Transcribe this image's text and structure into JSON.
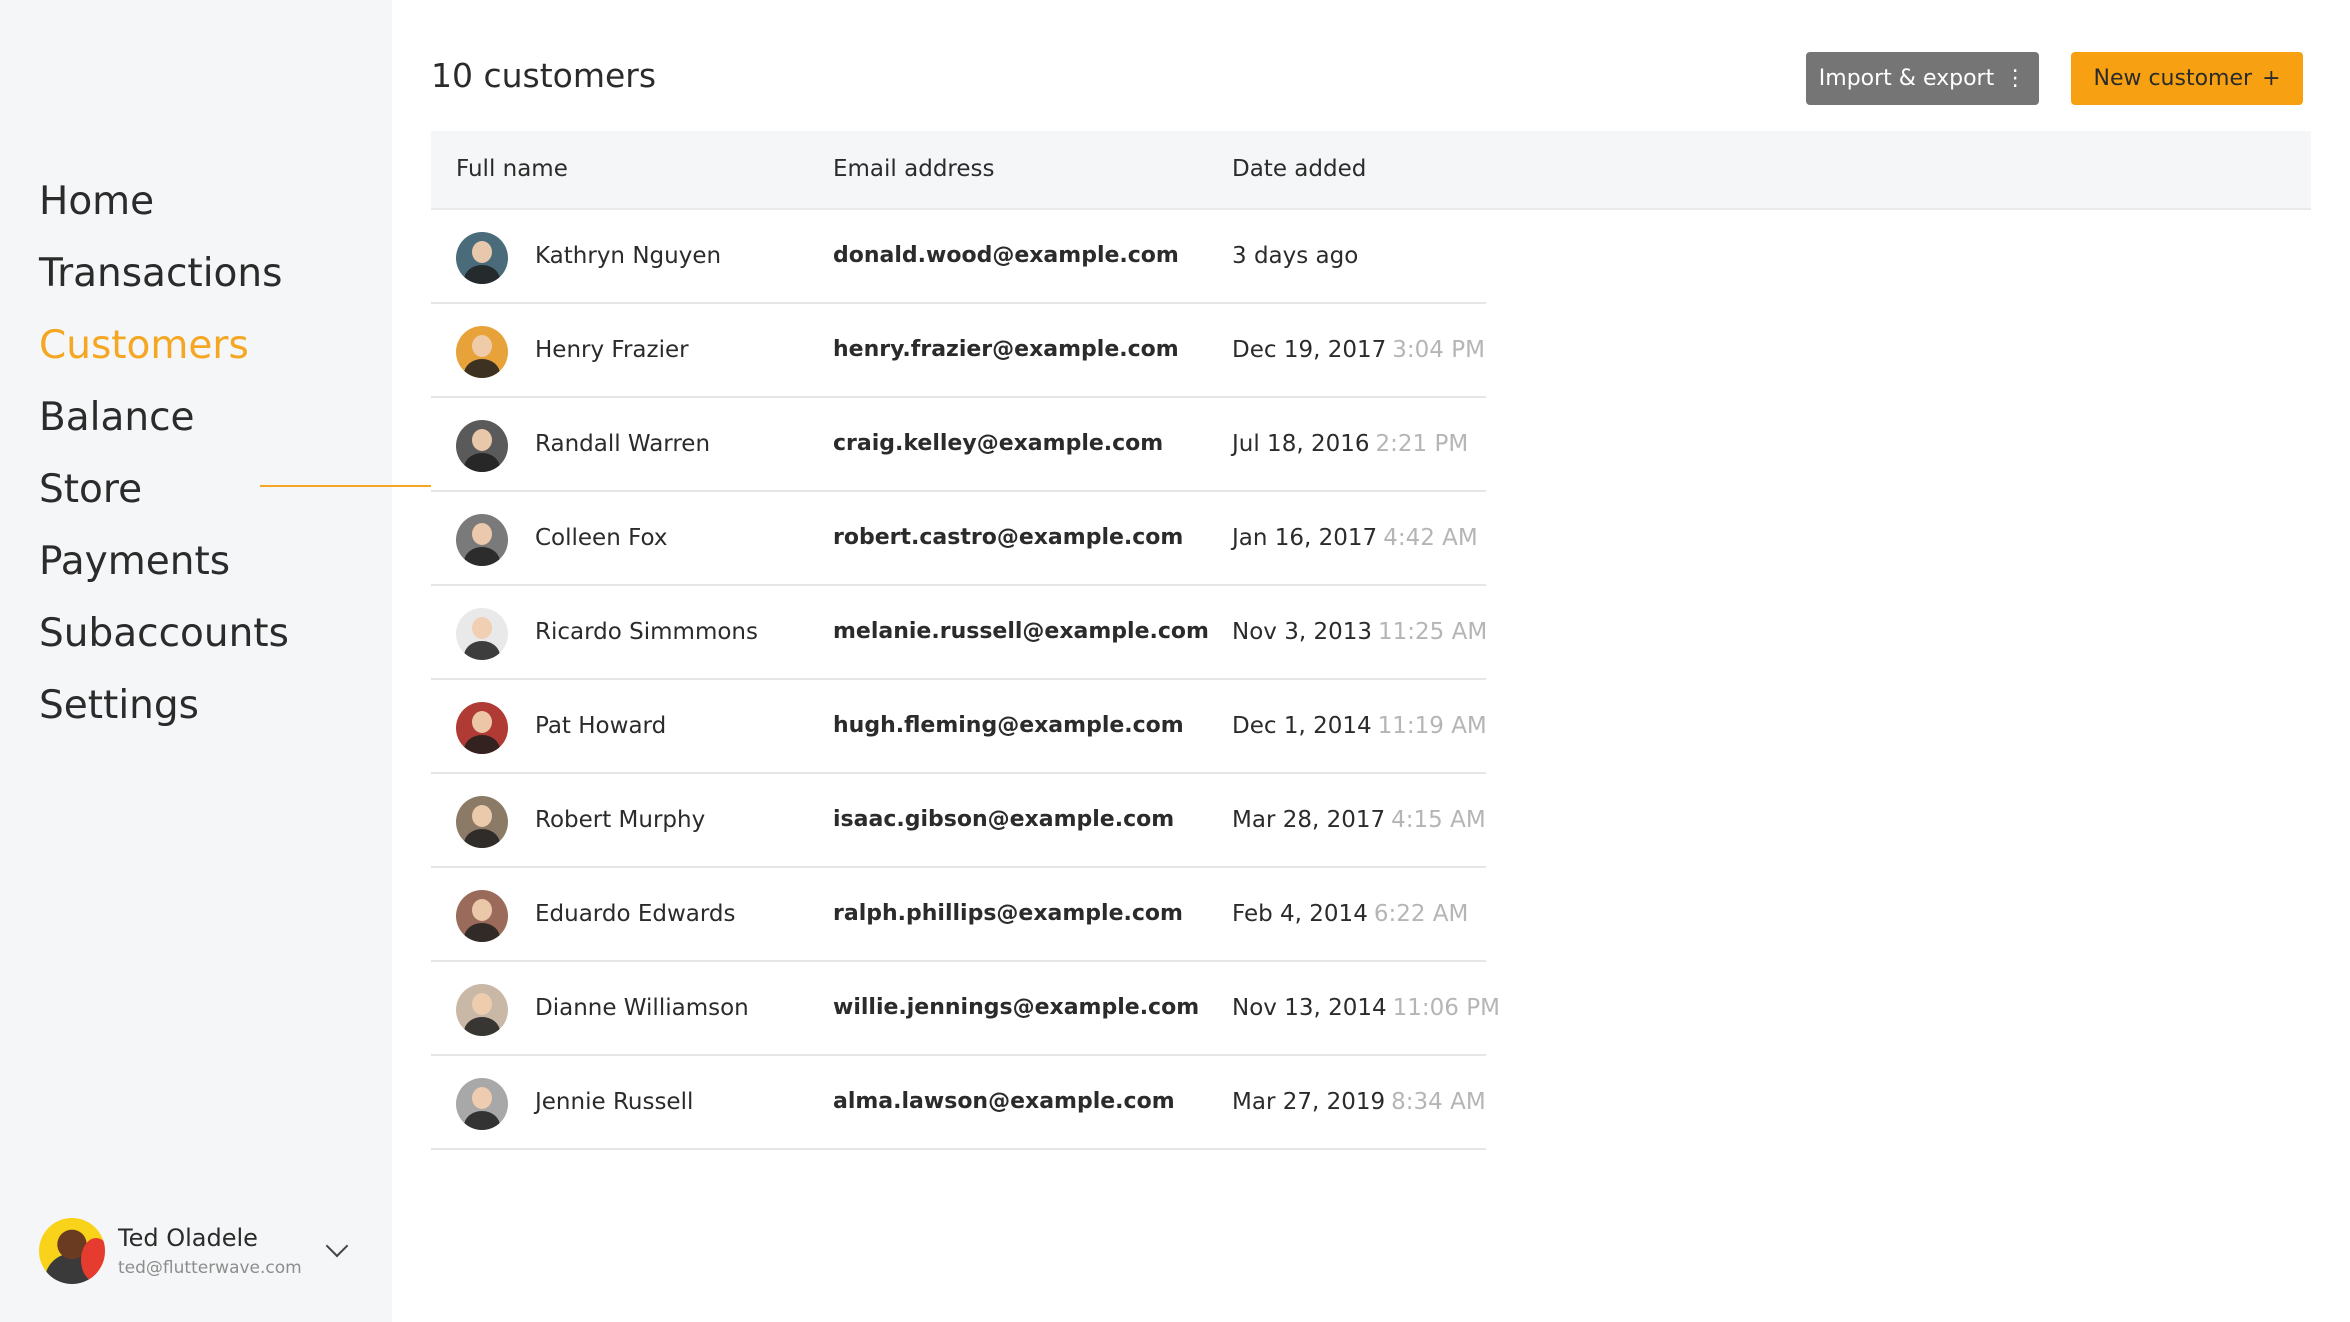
{
  "sidebar": {
    "nav": [
      "Home",
      "Transactions",
      "Customers",
      "Balance",
      "Store",
      "Payments",
      "Subaccounts",
      "Settings"
    ],
    "active": "Customers",
    "user": {
      "name": "Ted Oladele",
      "email": "ted@flutterwave.com"
    }
  },
  "header": {
    "title": "10 customers",
    "import_label": "Import & export",
    "new_label": "New customer"
  },
  "table": {
    "columns": [
      "Full name",
      "Email address",
      "Date added"
    ],
    "rows": [
      {
        "name": "Kathryn Nguyen",
        "email": "donald.wood@example.com",
        "date": "3 days ago",
        "time": "",
        "avatar_color": "#4a6b7a"
      },
      {
        "name": "Henry Frazier",
        "email": "henry.frazier@example.com",
        "date": "Dec 19, 2017",
        "time": "3:04 PM",
        "avatar_color": "#e8a23a"
      },
      {
        "name": "Randall Warren",
        "email": "craig.kelley@example.com",
        "date": "Jul 18, 2016",
        "time": "2:21 PM",
        "avatar_color": "#5a5a5a"
      },
      {
        "name": "Colleen Fox",
        "email": "robert.castro@example.com",
        "date": "Jan 16, 2017",
        "time": "4:42 AM",
        "avatar_color": "#7a7a7a"
      },
      {
        "name": "Ricardo Simmmons",
        "email": "melanie.russell@example.com",
        "date": "Nov 3, 2013",
        "time": "11:25 AM",
        "avatar_color": "#e9e9e9"
      },
      {
        "name": "Pat Howard",
        "email": "hugh.fleming@example.com",
        "date": "Dec 1, 2014",
        "time": "11:19 AM",
        "avatar_color": "#b03a34"
      },
      {
        "name": "Robert Murphy",
        "email": "isaac.gibson@example.com",
        "date": "Mar 28, 2017",
        "time": "4:15 AM",
        "avatar_color": "#8b7a66"
      },
      {
        "name": "Eduardo Edwards",
        "email": "ralph.phillips@example.com",
        "date": "Feb 4, 2014",
        "time": "6:22 AM",
        "avatar_color": "#9a6b5a"
      },
      {
        "name": "Dianne Williamson",
        "email": "willie.jennings@example.com",
        "date": "Nov 13, 2014",
        "time": "11:06 PM",
        "avatar_color": "#c9b8a6"
      },
      {
        "name": "Jennie Russell",
        "email": "alma.lawson@example.com",
        "date": "Mar 27, 2019",
        "time": "8:34 AM",
        "avatar_color": "#a8a8a8"
      }
    ]
  },
  "colors": {
    "accent": "#f5a623",
    "import_bg": "#757575",
    "new_bg": "#f7a112"
  },
  "icons": {
    "import": "more-vertical-icon",
    "new": "plus-icon",
    "user_menu": "chevron-down-icon"
  }
}
